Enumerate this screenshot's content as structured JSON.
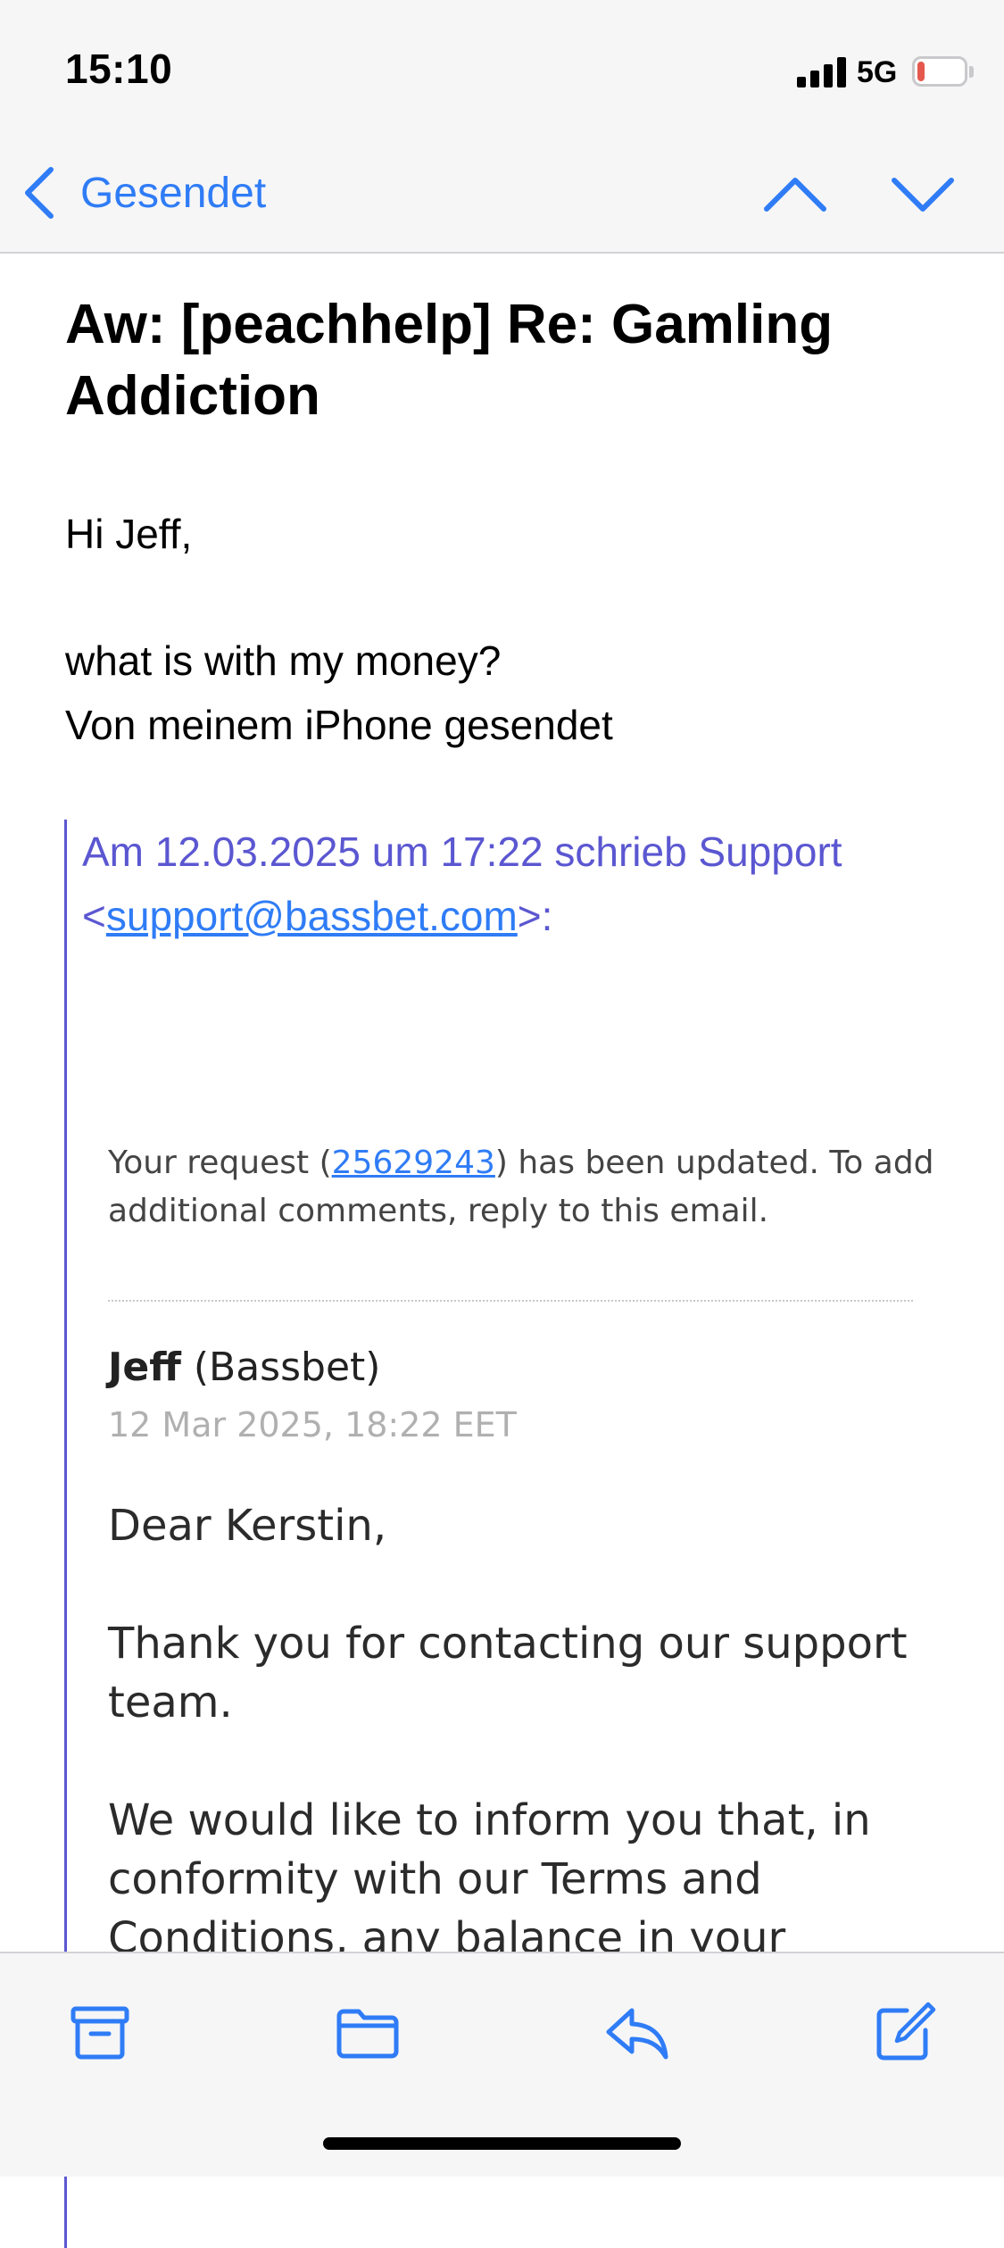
{
  "status_bar": {
    "time": "15:10",
    "network": "5G",
    "battery_level": "16",
    "battery_fraction": 0.16
  },
  "nav": {
    "back_label": "Gesendet",
    "icons": [
      "chevron-left-icon",
      "chevron-up-icon",
      "chevron-down-icon"
    ]
  },
  "email": {
    "subject": "Aw: [peachhelp] Re: Gamling Addiction",
    "greeting": "Hi Jeff,",
    "body_line1": "what is with my money?",
    "body_line2": "Von meinem iPhone gesendet",
    "quote": {
      "header_prefix": "Am 12.03.2025 um 17:22 schrieb Support <",
      "header_email": "support@bassbet.com",
      "header_suffix": ">:"
    },
    "support_message": {
      "note_prefix": "Your request (",
      "ticket_number": "25629243",
      "note_suffix": ") has been updated. To add additional comments, reply to this email.",
      "author_name": "Jeff",
      "author_org": "(Bassbet)",
      "date": "12 Mar 2025, 18:22 EET",
      "salutation": "Dear Kerstin,",
      "paragraph1": "Thank you for contacting our support team.",
      "paragraph2": "We would like to inform you that, in conformity with our Terms and Conditions, any balance in your"
    }
  },
  "toolbar": {
    "icons": [
      "archive-icon",
      "folder-icon",
      "reply-icon",
      "compose-icon"
    ]
  },
  "colors": {
    "accent": "#2f7cf6",
    "quote": "#5b57d1",
    "battery_low": "#e5584d"
  }
}
